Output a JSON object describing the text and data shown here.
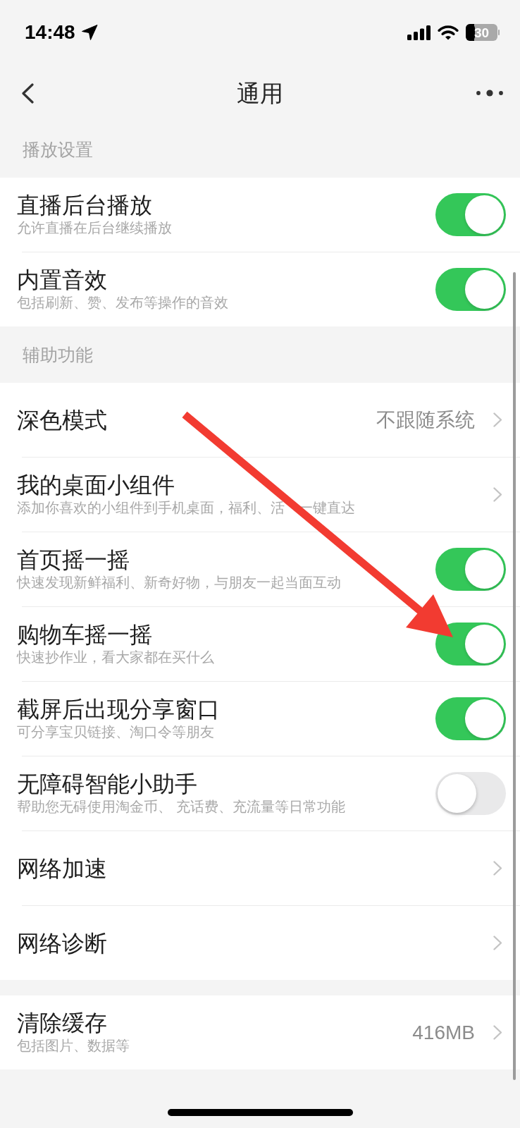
{
  "status_bar": {
    "time": "14:48",
    "battery": "30"
  },
  "nav": {
    "title": "通用"
  },
  "sections": [
    {
      "header": "播放设置",
      "rows": [
        {
          "kind": "toggle",
          "title": "直播后台播放",
          "subtitle": "允许直播在后台继续播放",
          "on": true
        },
        {
          "kind": "toggle",
          "title": "内置音效",
          "subtitle": "包括刷新、赞、发布等操作的音效",
          "on": true
        }
      ]
    },
    {
      "header": "辅助功能",
      "rows": [
        {
          "kind": "link",
          "title": "深色模式",
          "value": "不跟随系统"
        },
        {
          "kind": "link",
          "title": "我的桌面小组件",
          "subtitle_parts": [
            "添加你喜欢的小组件到手机桌面，福利、活",
            "一键直达"
          ]
        },
        {
          "kind": "toggle",
          "title": "首页摇一摇",
          "subtitle": "快速发现新鲜福利、新奇好物，与朋友一起当面互动",
          "on": true
        },
        {
          "kind": "toggle",
          "title": "购物车摇一摇",
          "subtitle": "快速抄作业，看大家都在买什么",
          "on": true
        },
        {
          "kind": "toggle",
          "title": "截屏后出现分享窗口",
          "subtitle": "可分享宝贝链接、淘口令等朋友",
          "on": true
        },
        {
          "kind": "toggle",
          "title": "无障碍智能小助手",
          "subtitle": "帮助您无碍使用淘金币、 充话费、充流量等日常功能",
          "on": false
        },
        {
          "kind": "link",
          "title": "网络加速"
        },
        {
          "kind": "link",
          "title": "网络诊断"
        }
      ]
    },
    {
      "rows": [
        {
          "kind": "link",
          "title": "清除缓存",
          "subtitle": "包括图片、数据等",
          "value": "416MB"
        }
      ]
    }
  ],
  "annotation": {
    "kind": "arrow"
  }
}
